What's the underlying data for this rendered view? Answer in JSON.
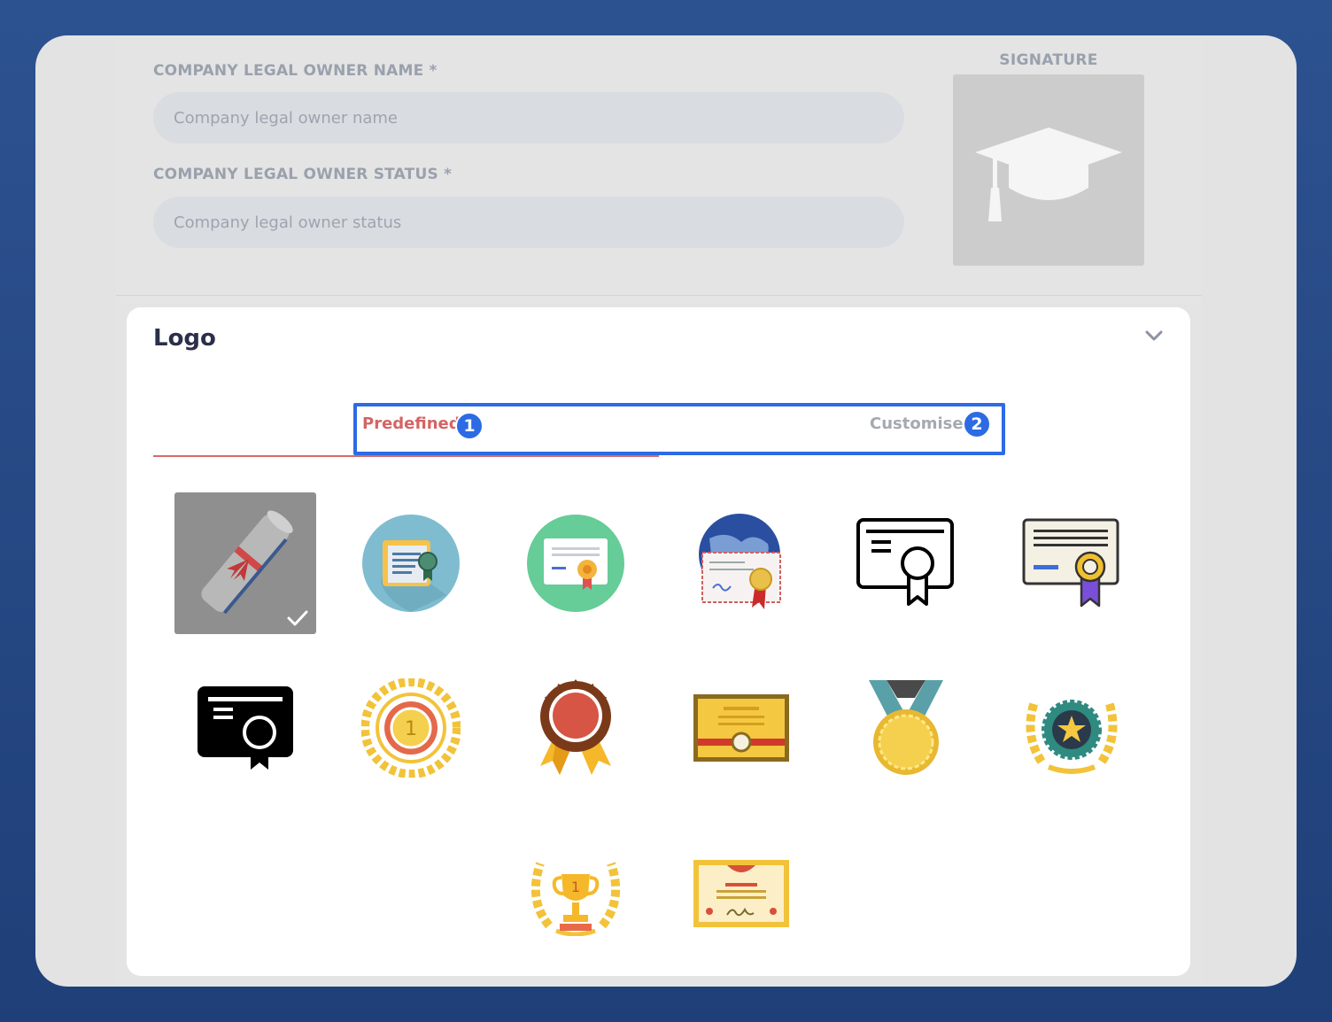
{
  "form": {
    "owner_name_label": "COMPANY LEGAL OWNER NAME *",
    "owner_name_placeholder": "Company legal owner name",
    "owner_status_label": "COMPANY LEGAL OWNER STATUS *",
    "owner_status_placeholder": "Company legal owner status",
    "signature_label": "SIGNATURE",
    "signature_icon": "graduation-cap-icon"
  },
  "logo_section": {
    "title": "Logo",
    "toggle_icon": "chevron-down-icon",
    "tabs": [
      {
        "label": "Predefined",
        "badge": "1",
        "active": true
      },
      {
        "label": "Customise",
        "badge": "2",
        "active": false
      }
    ],
    "highlight_color": "#2c6be4",
    "active_tab_color": "#d56464",
    "logos": [
      {
        "name": "diploma-scroll-icon",
        "selected": true
      },
      {
        "name": "certificate-document-circle-icon",
        "selected": false
      },
      {
        "name": "certificate-card-circle-icon",
        "selected": false
      },
      {
        "name": "globe-certificate-icon",
        "selected": false
      },
      {
        "name": "certificate-outline-icon",
        "selected": false
      },
      {
        "name": "certificate-ribbon-icon",
        "selected": false
      },
      {
        "name": "certificate-solid-icon",
        "selected": false
      },
      {
        "name": "laurel-first-place-medal-icon",
        "selected": false
      },
      {
        "name": "rosette-ribbon-icon",
        "selected": false
      },
      {
        "name": "gold-diploma-icon",
        "selected": false
      },
      {
        "name": "gold-medal-icon",
        "selected": false
      },
      {
        "name": "laurel-star-badge-icon",
        "selected": false
      },
      {
        "name": "laurel-trophy-icon",
        "selected": false
      },
      {
        "name": "award-certificate-icon",
        "selected": false
      }
    ]
  }
}
